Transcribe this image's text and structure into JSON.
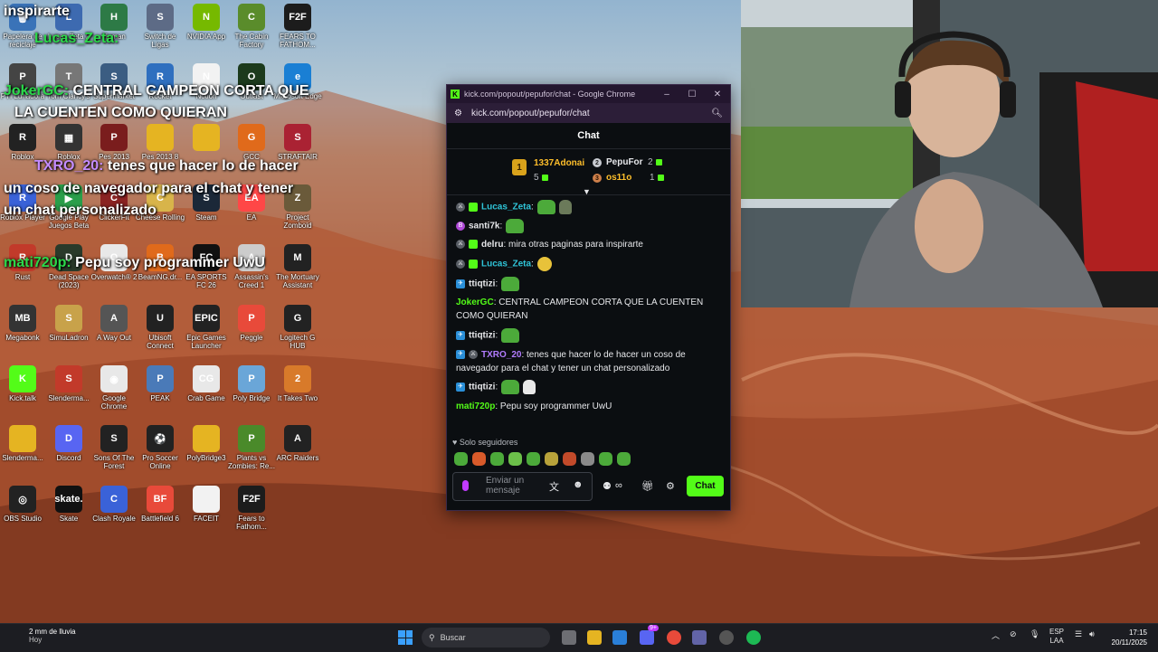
{
  "desktop": {
    "icons": [
      {
        "label": "Papelera de reciclaje",
        "color": "#3a73b8",
        "glyph": "🗑"
      },
      {
        "label": "Lucas Zeta 2",
        "color": "#3d6ab0",
        "glyph": "L"
      },
      {
        "label": "Human",
        "color": "#2d7a46",
        "glyph": "H"
      },
      {
        "label": "Switch de Ligas",
        "color": "#5d6b86",
        "glyph": "S"
      },
      {
        "label": "NVIDIA App",
        "color": "#76b900",
        "glyph": "N"
      },
      {
        "label": "The Cabin Factory",
        "color": "#5a8c2b",
        "glyph": "C"
      },
      {
        "label": "FEARS TO FATHOM...",
        "color": "#1c1c1c",
        "glyph": "F2F"
      },
      {
        "label": "PTI Lunadora",
        "color": "#444",
        "glyph": "P"
      },
      {
        "label": "Tom Clancy's",
        "color": "#777",
        "glyph": "T"
      },
      {
        "label": "Supermarket",
        "color": "#3b5d82",
        "glyph": "S"
      },
      {
        "label": "Rocket",
        "color": "#2f6fbf",
        "glyph": "R"
      },
      {
        "label": "Notion",
        "color": "#f2f2f2",
        "glyph": "N"
      },
      {
        "label": "Outlast",
        "color": "#1c3a1c",
        "glyph": "O"
      },
      {
        "label": "Microsoft Edge",
        "color": "#1a7fd4",
        "glyph": "e"
      },
      {
        "label": "Roblox",
        "color": "#222",
        "glyph": "R"
      },
      {
        "label": "Roblox",
        "color": "#333",
        "glyph": "▦"
      },
      {
        "label": "Pes 2013",
        "color": "#7a1d1d",
        "glyph": "P"
      },
      {
        "label": "Pes 2013 8",
        "color": "#e5b422",
        "glyph": ""
      },
      {
        "label": "",
        "color": "#e5b422",
        "glyph": ""
      },
      {
        "label": "GCC",
        "color": "#e06a1b",
        "glyph": "G"
      },
      {
        "label": "STRAFTAIR",
        "color": "#aa2233",
        "glyph": "S"
      },
      {
        "label": "Roblox Player",
        "color": "#3a62d8",
        "glyph": "R"
      },
      {
        "label": "Google Play Juegos Beta",
        "color": "#2a9e4a",
        "glyph": "▶"
      },
      {
        "label": "ClickerFit",
        "color": "#8a2222",
        "glyph": "C"
      },
      {
        "label": "Cheese Rolling",
        "color": "#d8b44a",
        "glyph": "C"
      },
      {
        "label": "Steam",
        "color": "#1b2838",
        "glyph": "S"
      },
      {
        "label": "EA",
        "color": "#ff4747",
        "glyph": "EA"
      },
      {
        "label": "Project Zomboid",
        "color": "#6a5a3a",
        "glyph": "Z"
      },
      {
        "label": "Rust",
        "color": "#c23a2a",
        "glyph": "R"
      },
      {
        "label": "Dead Space (2023)",
        "color": "#2a3a2a",
        "glyph": "D"
      },
      {
        "label": "Overwatch® 2",
        "color": "#e8e8e8",
        "glyph": "O"
      },
      {
        "label": "BeamNG.dr...",
        "color": "#e06a1b",
        "glyph": "B"
      },
      {
        "label": "EA SPORTS FC 26",
        "color": "#111",
        "glyph": "FC"
      },
      {
        "label": "Assassin's Creed 1",
        "color": "#ccc",
        "glyph": "A"
      },
      {
        "label": "The Mortuary Assistant",
        "color": "#222",
        "glyph": "M"
      },
      {
        "label": "Megabonk",
        "color": "#333",
        "glyph": "MB"
      },
      {
        "label": "SimuLadron",
        "color": "#c8a24a",
        "glyph": "S"
      },
      {
        "label": "A Way Out",
        "color": "#555",
        "glyph": "A"
      },
      {
        "label": "Ubisoft Connect",
        "color": "#222",
        "glyph": "U"
      },
      {
        "label": "Epic Games Launcher",
        "color": "#222",
        "glyph": "EPIC"
      },
      {
        "label": "Peggle",
        "color": "#e84a3a",
        "glyph": "P"
      },
      {
        "label": "Logitech G HUB",
        "color": "#222",
        "glyph": "G"
      },
      {
        "label": "Kick.talk",
        "color": "#53fc18",
        "glyph": "K"
      },
      {
        "label": "Slenderma...",
        "color": "#c23a2a",
        "glyph": "S"
      },
      {
        "label": "Google Chrome",
        "color": "#e8e8e8",
        "glyph": "◉"
      },
      {
        "label": "PEAK",
        "color": "#4a7ab8",
        "glyph": "P"
      },
      {
        "label": "Crab Game",
        "color": "#e8e8e8",
        "glyph": "CG"
      },
      {
        "label": "Poly Bridge",
        "color": "#6aa6d8",
        "glyph": "P"
      },
      {
        "label": "It Takes Two",
        "color": "#d87a2a",
        "glyph": "2"
      },
      {
        "label": "Slenderma...",
        "color": "#e5b422",
        "glyph": ""
      },
      {
        "label": "Discord",
        "color": "#5865f2",
        "glyph": "D"
      },
      {
        "label": "Sons Of The Forest",
        "color": "#222",
        "glyph": "S"
      },
      {
        "label": "Pro Soccer Online",
        "color": "#222",
        "glyph": "⚽"
      },
      {
        "label": "PolyBridge3",
        "color": "#e5b422",
        "glyph": ""
      },
      {
        "label": "Plants vs Zombies: Re...",
        "color": "#4a8a2a",
        "glyph": "P"
      },
      {
        "label": "ARC Raiders",
        "color": "#222",
        "glyph": "A"
      },
      {
        "label": "OBS Studio",
        "color": "#222",
        "glyph": "◎"
      },
      {
        "label": "Skate",
        "color": "#111",
        "glyph": "skate."
      },
      {
        "label": "Clash Royale",
        "color": "#3a62d8",
        "glyph": "C"
      },
      {
        "label": "Battlefield 6",
        "color": "#e84a3a",
        "glyph": "BF"
      },
      {
        "label": "FACEIT",
        "color": "#f2f2f2",
        "glyph": ""
      },
      {
        "label": "Fears to Fathom...",
        "color": "#1c1c1c",
        "glyph": "F2F"
      }
    ]
  },
  "overlay": {
    "line0": "inspirarte",
    "line1_name": "Lucas_Zeta:",
    "line2_name": "JokerGC:",
    "line2_text": "CENTRAL CAMPEON CORTA QUE",
    "line2_text_b": "LA CUENTEN COMO QUIERAN",
    "line3_name": "TXRO_20:",
    "line3_text": "tenes que hacer lo de hacer",
    "line3_text_b": "un coso de navegador para el chat y tener",
    "line3_text_c": "un chat personalizado",
    "line4_name": "mati720p:",
    "line4_text": "Pepu soy programmer UwU"
  },
  "window": {
    "title": "kick.com/popout/pepufor/chat - Google Chrome",
    "url": "kick.com/popout/pepufor/chat",
    "minimize": "–",
    "maximize": "☐",
    "close": "✕",
    "chat_header": "Chat",
    "leaderboard": {
      "first": {
        "rank": "1",
        "name": "1337Adonai",
        "count": "5"
      },
      "second": {
        "name": "PepuFor",
        "count": "2"
      },
      "third": {
        "name": "os11o",
        "count": "1"
      }
    },
    "messages": [
      {
        "user": "Lucas_Zeta",
        "text": "",
        "color": "#2fc4d8"
      },
      {
        "user": "santi7k",
        "text": "",
        "color": "#e6e7ea"
      },
      {
        "user": "delru",
        "text": "mira otras paginas para inspirarte",
        "color": "#e6e7ea"
      },
      {
        "user": "Lucas_Zeta",
        "text": "",
        "color": "#2fc4d8"
      },
      {
        "user": "ttiqtizi",
        "text": "",
        "color": "#e6e7ea"
      },
      {
        "user": "JokerGC",
        "text": "CENTRAL CAMPEON CORTA QUE LA CUENTEN COMO QUIERAN",
        "color": "#53fc18"
      },
      {
        "user": "ttiqtizi",
        "text": "",
        "color": "#e6e7ea"
      },
      {
        "user": "TXRO_20",
        "text": "tenes que hacer lo de hacer un coso de navegador para el chat y tener un chat personalizado",
        "color": "#b27cff"
      },
      {
        "user": "ttiqtizi",
        "text": "",
        "color": "#e6e7ea"
      },
      {
        "user": "mati720p",
        "text": "Pepu soy programmer UwU",
        "color": "#53fc18"
      }
    ],
    "followers_only": "Solo seguidores",
    "input_placeholder": "Enviar un mensaje",
    "send_button": "Chat"
  },
  "taskbar": {
    "weather_title": "2 mm de lluvia",
    "weather_sub": "Hoy",
    "search_placeholder": "Buscar",
    "language": "ESP",
    "language_sub": "LAA",
    "time": "17:15",
    "date": "20/11/2025",
    "notification_count": "9+"
  },
  "colors": {
    "kick_green": "#53fc18",
    "title_purple": "#23162e"
  }
}
